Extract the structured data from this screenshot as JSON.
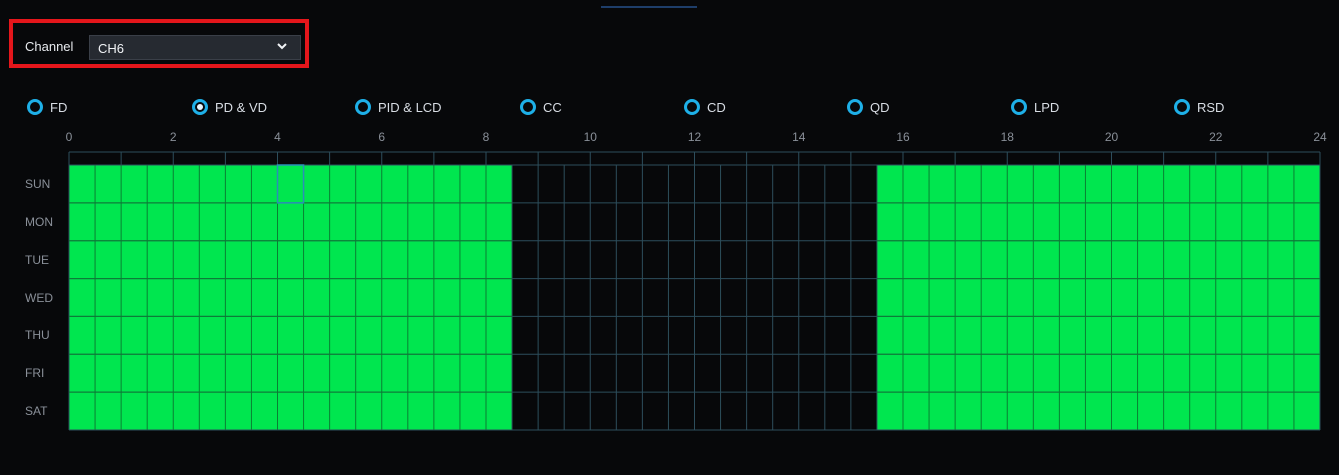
{
  "channel": {
    "label": "Channel",
    "selected": "CH6"
  },
  "detection_types": [
    {
      "label": "FD",
      "checked": false
    },
    {
      "label": "PD & VD",
      "checked": true
    },
    {
      "label": "PID & LCD",
      "checked": false
    },
    {
      "label": "CC",
      "checked": false
    },
    {
      "label": "CD",
      "checked": false
    },
    {
      "label": "QD",
      "checked": false
    },
    {
      "label": "LPD",
      "checked": false
    },
    {
      "label": "RSD",
      "checked": false
    }
  ],
  "schedule": {
    "hour_labels": [
      "0",
      "2",
      "4",
      "6",
      "8",
      "10",
      "12",
      "14",
      "16",
      "18",
      "20",
      "22",
      "24"
    ],
    "days": [
      "SUN",
      "MON",
      "TUE",
      "WED",
      "THU",
      "FRI",
      "SAT"
    ],
    "active_ranges_hours": [
      [
        0,
        8.5
      ],
      [
        15.5,
        24
      ]
    ],
    "active_color": "#00e64f",
    "grid_color": "#2d4e5c",
    "selected_cell": {
      "day": "SUN",
      "hour": 4
    }
  },
  "colors": {
    "radio_accent": "#1eb0e8",
    "highlight_border": "#e5161b"
  }
}
